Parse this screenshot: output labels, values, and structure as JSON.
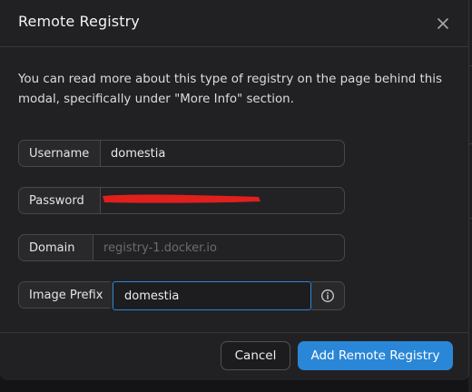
{
  "modal": {
    "title": "Remote Registry",
    "description": "You can read more about this type of registry on the page behind this modal, specifically under \"More Info\" section."
  },
  "form": {
    "username": {
      "label": "Username",
      "value": "domestia"
    },
    "password": {
      "label": "Password",
      "value": ""
    },
    "domain": {
      "label": "Domain",
      "value": "",
      "placeholder": "registry-1.docker.io"
    },
    "image_prefix": {
      "label": "Image Prefix",
      "value": "domestia"
    }
  },
  "footer": {
    "cancel_label": "Cancel",
    "submit_label": "Add Remote Registry"
  },
  "colors": {
    "accent": "#2a86d6",
    "redaction": "#e0201c"
  },
  "icons": {
    "close": "close-icon",
    "info": "info-icon"
  }
}
